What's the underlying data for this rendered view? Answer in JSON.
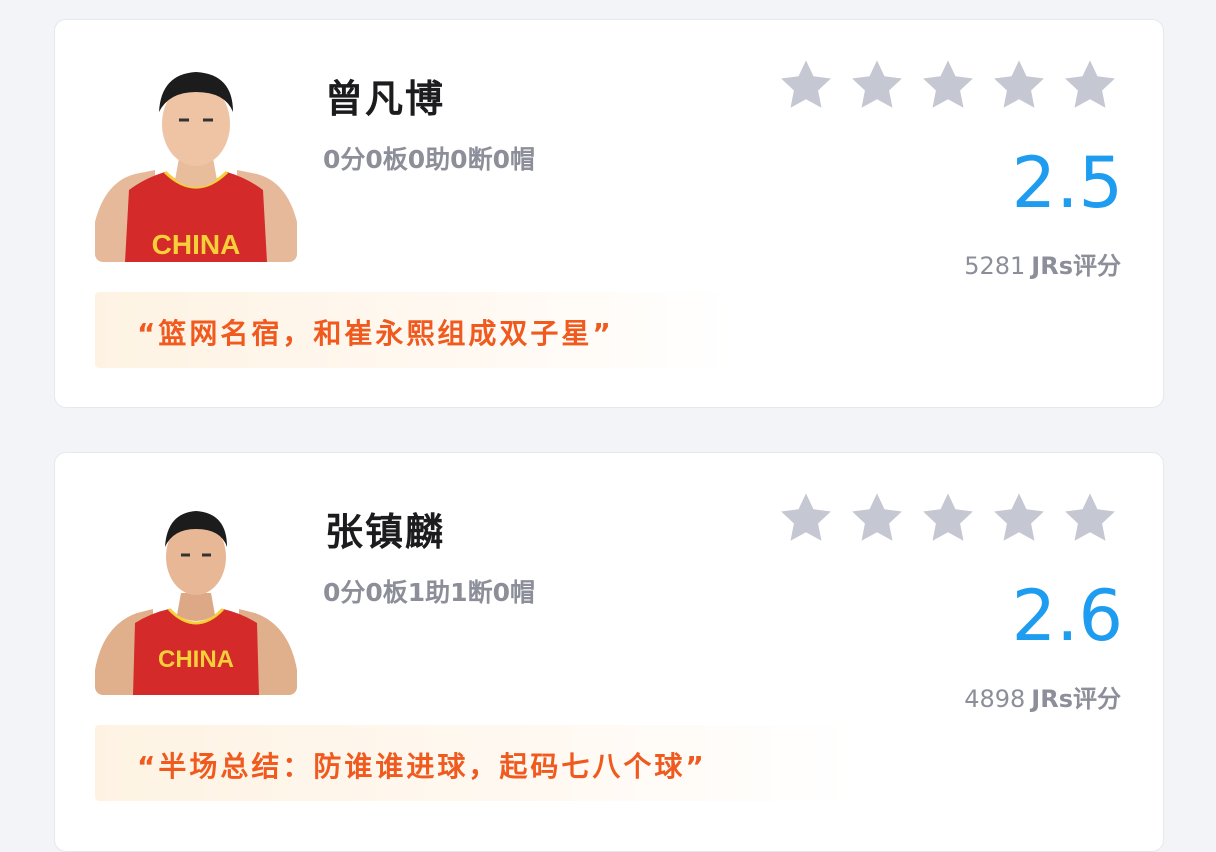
{
  "players": [
    {
      "name": "曾凡博",
      "stats": "0分0板0助0断0帽",
      "score": "2.5",
      "rating_count": "5281",
      "rating_unit": "JRs评分",
      "stars_filled": 0,
      "stars_total": 5,
      "jersey_text": "CHINA",
      "quote": "“篮网名宿，和崔永熙组成双子星”"
    },
    {
      "name": "张镇麟",
      "stats": "0分0板1助1断0帽",
      "score": "2.6",
      "rating_count": "4898",
      "rating_unit": "JRs评分",
      "stars_filled": 0,
      "stars_total": 5,
      "jersey_text": "CHINA",
      "quote": "“半场总结：防谁谁进球，起码七八个球”"
    }
  ],
  "colors": {
    "score": "#1e9cf0",
    "quote_text": "#f05a1e",
    "star_empty": "#c5c8d2",
    "jersey": "#d42a2a"
  },
  "icons": {
    "star": "star-icon"
  }
}
